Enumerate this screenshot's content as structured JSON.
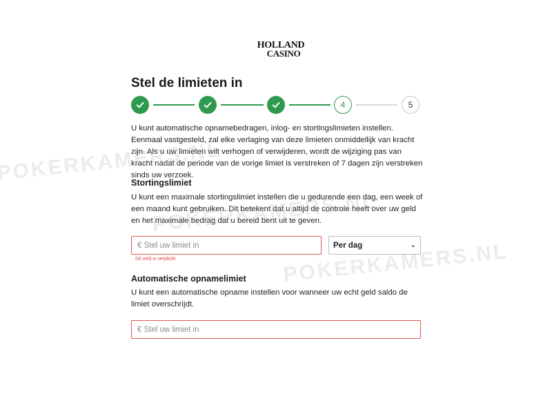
{
  "logo": {
    "line1": "HOLLAND",
    "line2": "CASINO"
  },
  "page": {
    "title": "Stel de limieten in"
  },
  "stepper": {
    "step4": "4",
    "step5": "5"
  },
  "intro": "U kunt automatische opnamebedragen, inlog- en stortingslimieten instellen. Eenmaal vastgesteld, zal elke verlaging van deze limieten onmiddellijk van kracht zijn. Als u uw limieten wilt verhogen of verwijderen, wordt de wijziging pas van kracht nadat de periode van de vorige limiet is verstreken of 7 dagen zijn verstreken sinds uw verzoek.",
  "deposit": {
    "heading": "Stortingslimiet",
    "text": "U kunt een maximale stortingslimiet instellen die u gedurende een dag, een week of een maand kunt gebruiken. Dit betekent dat u altijd de controle heeft over uw geld en het maximale bedrag dat u bereid bent uit te geven.",
    "placeholder": "€ Stel uw limiet in",
    "error": "Dit veld is verplicht",
    "period": "Per dag"
  },
  "withdraw": {
    "heading": "Automatische opnamelimiet",
    "text": "U kunt een automatische opname instellen voor wanneer uw echt geld saldo de limiet overschrijdt.",
    "placeholder": "€ Stel uw limiet in"
  },
  "watermark": "POKERKAMERS.NL",
  "colors": {
    "success": "#2e9a4f",
    "error": "#e05a5a"
  },
  "icons": {
    "completed": "check-icon",
    "dropdown": "chevron-down-icon"
  }
}
